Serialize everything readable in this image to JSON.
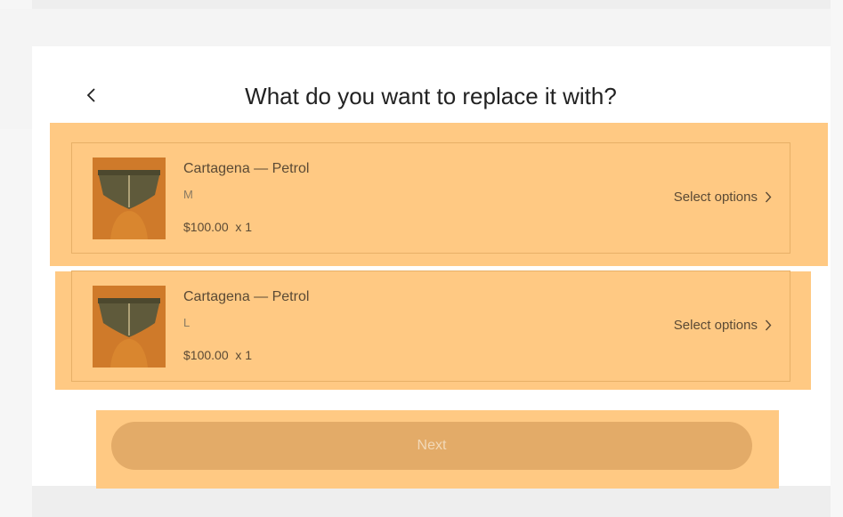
{
  "header": {
    "title": "What do you want to replace it with?"
  },
  "items": [
    {
      "name": "Cartagena — Petrol",
      "size": "M",
      "price": "$100.00",
      "qty": "x 1",
      "action": "Select options"
    },
    {
      "name": "Cartagena — Petrol",
      "size": "L",
      "price": "$100.00",
      "qty": "x 1",
      "action": "Select options"
    }
  ],
  "footer": {
    "next_label": "Next"
  },
  "colors": {
    "highlight": "#ffc983",
    "border": "#e7b067",
    "button": "#e3ab68",
    "text": "#5b4a35"
  },
  "icons": {
    "back": "chevron-left-icon",
    "select": "chevron-right-icon"
  }
}
